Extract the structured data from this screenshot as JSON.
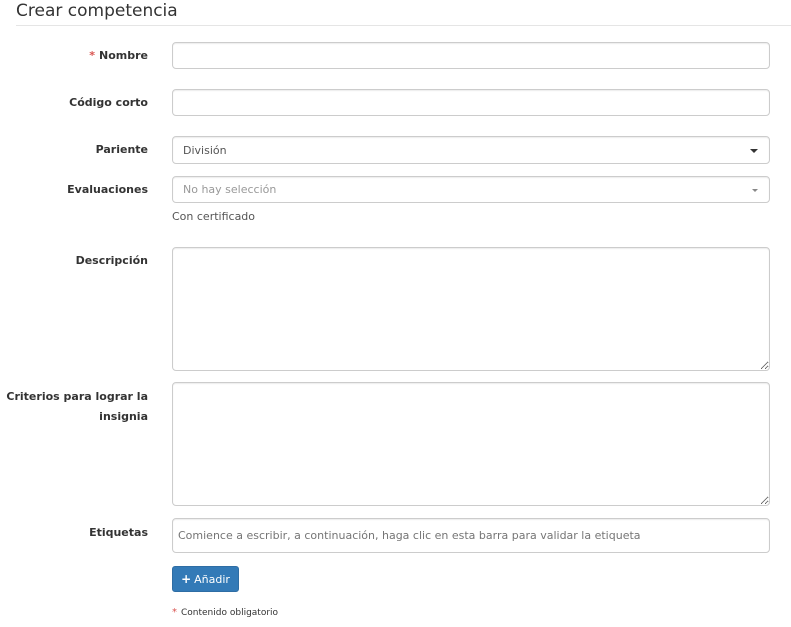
{
  "page": {
    "title": "Crear competencia"
  },
  "form": {
    "name": {
      "label": "Nombre",
      "required_mark": "*",
      "value": "",
      "placeholder": ""
    },
    "short_code": {
      "label": "Código corto",
      "value": "",
      "placeholder": ""
    },
    "parent": {
      "label": "Pariente",
      "selected": "División"
    },
    "evaluations": {
      "label": "Evaluaciones",
      "placeholder": "No hay selección",
      "help": "Con certificado"
    },
    "description": {
      "label": "Descripción",
      "value": ""
    },
    "criteria": {
      "label_line1": "Criterios para lograr la",
      "label_line2": "insignia",
      "value": ""
    },
    "tags": {
      "label": "Etiquetas",
      "placeholder": "Comience a escribir, a continuación, haga clic en esta barra para validar la etiqueta"
    },
    "add_button": {
      "icon": "plus-icon",
      "icon_glyph": "+",
      "label": "Añadir"
    },
    "footnote": {
      "mark": "*",
      "text": "Contenido obligatorio"
    }
  },
  "colors": {
    "primary": "#337ab7",
    "required": "#d9534f",
    "border": "#cccccc"
  }
}
